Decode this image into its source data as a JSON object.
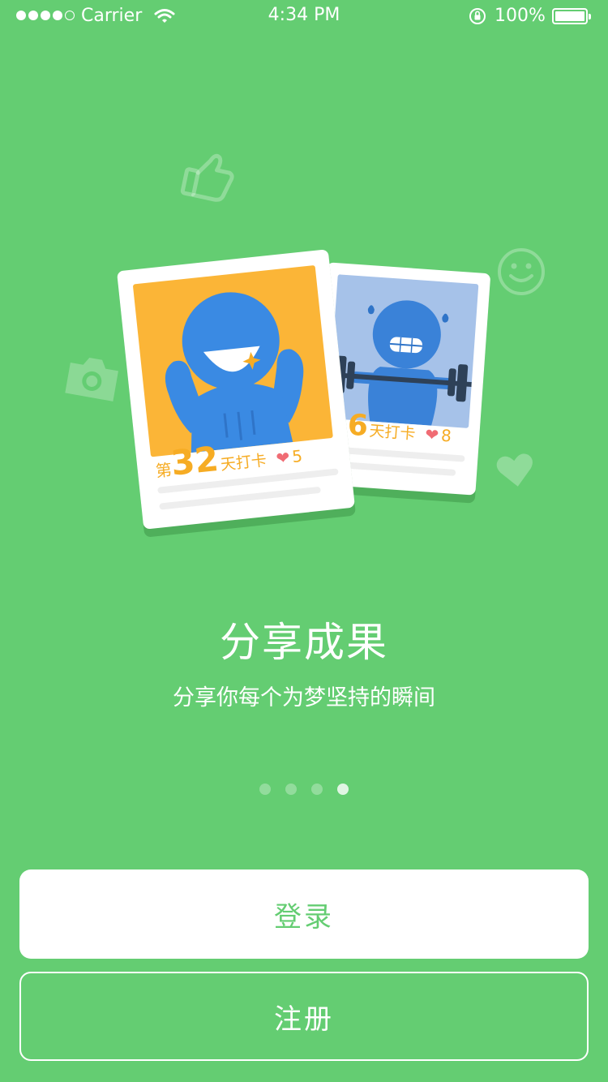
{
  "status_bar": {
    "carrier": "Carrier",
    "time": "4:34 PM",
    "battery": "100%",
    "signal_bars_filled": 4,
    "signal_bars_total": 5
  },
  "cards": [
    {
      "prefix": "第",
      "days": "32",
      "suffix": "天打卡",
      "likes": "5"
    },
    {
      "prefix": "",
      "days": "56",
      "suffix": "天打卡",
      "likes": "8"
    }
  ],
  "title": "分享成果",
  "subtitle": "分享你每个为梦坚持的瞬间",
  "pagination": {
    "count": 4,
    "active_index": 3
  },
  "buttons": {
    "login": "登录",
    "register": "注册"
  },
  "colors": {
    "background": "#64cd72",
    "card_yellow": "#fbb537",
    "card_blue": "#a6c2e9",
    "figure_blue": "#3a8ae3",
    "number_orange": "#f6ac24",
    "heart_red": "#f06c74"
  },
  "icons": [
    "thumbs-up-icon",
    "smiley-icon",
    "camera-icon",
    "heart-icon",
    "wifi-icon",
    "rotation-lock-icon",
    "battery-icon"
  ]
}
